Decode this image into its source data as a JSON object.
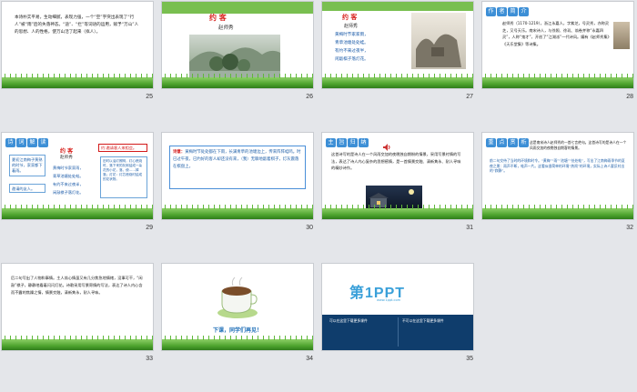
{
  "slides": [
    {
      "number": "25",
      "text": "本诗朴实平易，生动细腻，表现力强，一个“空”字突出表现了“行人”被“雨”后的失落神态。“途”、“拦”等词语的运用，赋予“万山”人的思想、人的性格，使万山活了起来（拟人）。"
    },
    {
      "number": "26",
      "title": "约 客",
      "author": "赵师秀"
    },
    {
      "number": "27",
      "title": "约 客",
      "author": "赵师秀",
      "lines": [
        "黄梅时节家家雨，",
        "青草池塘处处蛙。",
        "有约不来过夜半，",
        "闲敲棋子落灯花。"
      ]
    },
    {
      "number": "28",
      "tag": [
        "作",
        "者",
        "简",
        "介"
      ],
      "text": "赵师秀（1170-1219），浙江永嘉人，字紫芝，号灵秀，亦称灵芝，又号天乐。南宋诗人，与徐照、徐玑、翁卷并称“永嘉四灵”，人称“鬼才”，开创了“江湖派”一代诗风。编有《赵师秀集》《天乐堂集》等诗集。"
    },
    {
      "number": "29",
      "tag": [
        "诗",
        "词",
        "解",
        "读"
      ],
      "title": "约 客",
      "author": "赵师秀",
      "note_top": "约:邀请客人来相会。",
      "lines": [
        "黄梅时节家家雨，",
        "青草池塘处处蛙。",
        "有约不来过夜半，",
        "闲敲棋子落灯花。"
      ],
      "note_left1": "夏初江南梅子黄熟的时节，家家都下着雨。",
      "note_left2": "邀请的友人。",
      "note_right": "旧时以油灯照明，灯心燃烧时，落下来的灰烬结成一朵花的小花，落，使……掉落；灯花：灯芯燃烧时结成的花状物。"
    },
    {
      "number": "30",
      "label": "诗意：",
      "text": "黄梅时节处处都在下雨，长满青草的池塘边上，传来阵阵蛙鸣。时已过午夜，已约好的客人却还没有来，（我）无聊地敲着棋子，灯灰震落在棋盘上。"
    },
    {
      "number": "31",
      "tag": [
        "主",
        "旨",
        "归",
        "纳"
      ],
      "text": "这首诗写的是诗人在一个风雨交加的夜晚独自期盼的情景，采用写景衬情的写法，表达了诗人内心复杂的思想感情，是一首情景交融、清新隽永、耐人寻味的精妙诗作。"
    },
    {
      "number": "32",
      "tag": [
        "重",
        "点",
        "赏",
        "析"
      ],
      "text1": "这是南宋诗人赵师秀的一首七言绝句。这首诗写的是诗人在一个风雨交加的夜晚独自期客的情景。",
      "text2": "前二句交待了当时的环境和时令。“黄梅”“雨”“池塘”“处处蛙”，写出了江南梅雨季节的夏夜之景：雨声不断，蛙声一片。这看似很简单的环境“热闹”的环境，实际上诗人要反衬出的“寂静”。"
    },
    {
      "number": "33",
      "text": "后二句写出了人物和事情。主人翁心情虽又有几分焦急地情绪，没事可干，“闲敲”棋子，静静地看着闪闪灯花。诗歌采用写景寄情的写法，表达了诗人内心含而不露的焦躁之情，情景交融，清新隽永，耐人寻味。"
    },
    {
      "number": "34",
      "caption": "下课，同学们再见！"
    },
    {
      "number": "35",
      "brand": "第1PPT",
      "url": "www.1ppt.com",
      "left_title": "可以在这里下载更多课件",
      "right_title": "不可以在这里下载更多课件"
    }
  ],
  "colors": {
    "accent_red": "#d31a1a",
    "accent_blue": "#1f5fa8",
    "grass": "#4ea42e",
    "background": "#e4e6ea"
  }
}
